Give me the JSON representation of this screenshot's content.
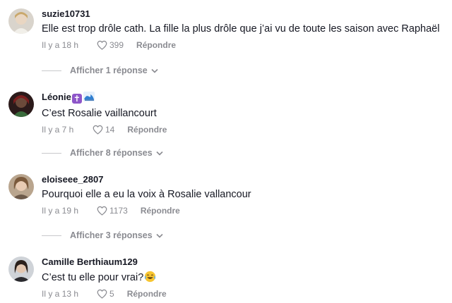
{
  "comments": [
    {
      "username": "suzie10731",
      "text": "Elle est trop drôle cath. La fille la plus drôle que j’ai vu de toute les saison avec Raphaël",
      "time": "Il y a 18 h",
      "likes": "399",
      "reply_label": "Répondre",
      "view_replies": "Afficher 1 réponse"
    },
    {
      "username": "Léonie",
      "username_emojis": [
        "cross-emoji",
        "wave-emoji"
      ],
      "text": "C’est Rosalie vaillancourt",
      "time": "Il y a 7 h",
      "likes": "14",
      "reply_label": "Répondre",
      "view_replies": "Afficher 8 réponses"
    },
    {
      "username": "eloiseee_2807",
      "text": "Pourquoi elle a eu la voix à Rosalie vallancour",
      "time": "Il y a 19 h",
      "likes": "1173",
      "reply_label": "Répondre",
      "view_replies": "Afficher 3 réponses"
    },
    {
      "username": "Camille Berthiaum129",
      "text": "C’est tu elle pour vrai?",
      "text_emoji": "laughing-tears-emoji",
      "time": "Il y a 13 h",
      "likes": "5",
      "reply_label": "Répondre"
    }
  ],
  "colors": {
    "text": "#161823",
    "meta": "#8a8b91",
    "divider": "#c8c9cc",
    "badge": "#8e56c9"
  }
}
